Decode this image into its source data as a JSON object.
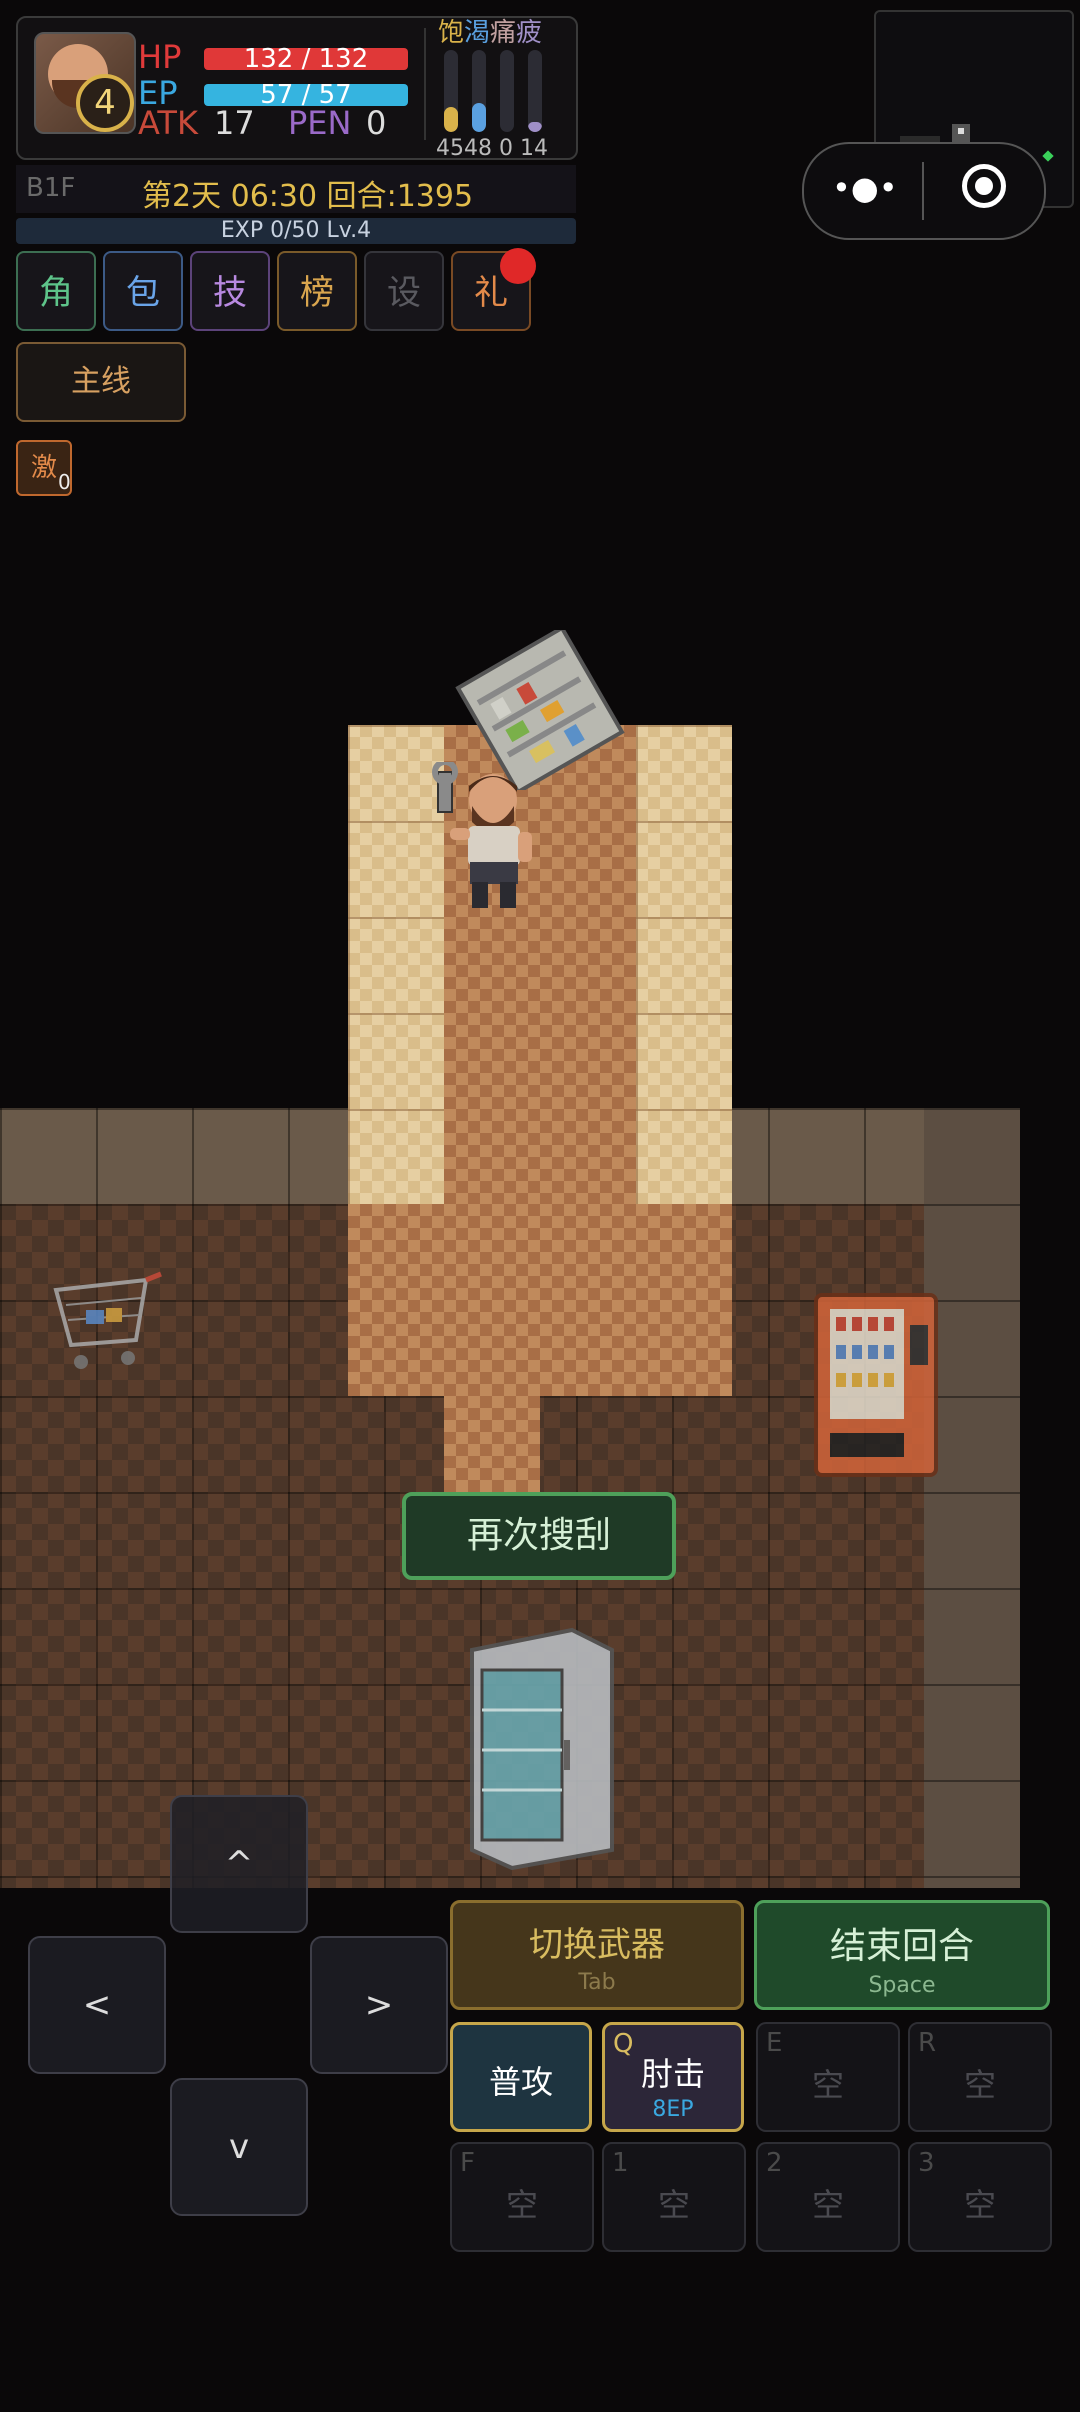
{
  "stats": {
    "level": "4",
    "hp_label": "HP",
    "hp_value": "132 / 132",
    "ep_label": "EP",
    "ep_value": "57 / 57",
    "atk_label": "ATK",
    "atk_value": "17",
    "pen_label": "PEN",
    "pen_value": "0"
  },
  "needs": {
    "labels": [
      "饱",
      "渴",
      "痛",
      "疲"
    ],
    "label_colors": [
      "#d9b24a",
      "#5aa0e0",
      "#c0a0a0",
      "#a090c8"
    ],
    "values": "4548 0 14",
    "levels": [
      0.3,
      0.35,
      0.0,
      0.12
    ]
  },
  "info": {
    "floor": "B1F",
    "time": "第2天 06:30 回合:1395"
  },
  "exp": "EXP 0/50 Lv.4",
  "menu": {
    "items": [
      {
        "label": "角",
        "color": "#5ec48a",
        "border": "#3c6e52"
      },
      {
        "label": "包",
        "color": "#6aa4e8",
        "border": "#3c5a86"
      },
      {
        "label": "技",
        "color": "#b889e0",
        "border": "#5c437a"
      },
      {
        "label": "榜",
        "color": "#d9a54e",
        "border": "#7a5a2a"
      },
      {
        "label": "设",
        "color": "#5a5a60",
        "border": "#35353b"
      },
      {
        "label": "礼",
        "color": "#e38a4a",
        "border": "#7a4a24"
      }
    ],
    "mainline": "主线",
    "boost": "激",
    "boost_count": "0"
  },
  "scene": {
    "action_prompt": "再次搜刮"
  },
  "dpad": {
    "up": "^",
    "left": "<",
    "right": ">",
    "down": "v"
  },
  "actions": {
    "switch_weapon": "切换武器",
    "switch_key": "Tab",
    "end_turn": "结束回合",
    "end_key": "Space",
    "normal_attack": "普攻",
    "elbow_key": "Q",
    "elbow": "肘击",
    "elbow_cost": "8EP",
    "slots": [
      {
        "key": "E",
        "label": "空"
      },
      {
        "key": "R",
        "label": "空"
      },
      {
        "key": "F",
        "label": "空"
      },
      {
        "key": "1",
        "label": "空"
      },
      {
        "key": "2",
        "label": "空"
      },
      {
        "key": "3",
        "label": "空"
      }
    ]
  }
}
